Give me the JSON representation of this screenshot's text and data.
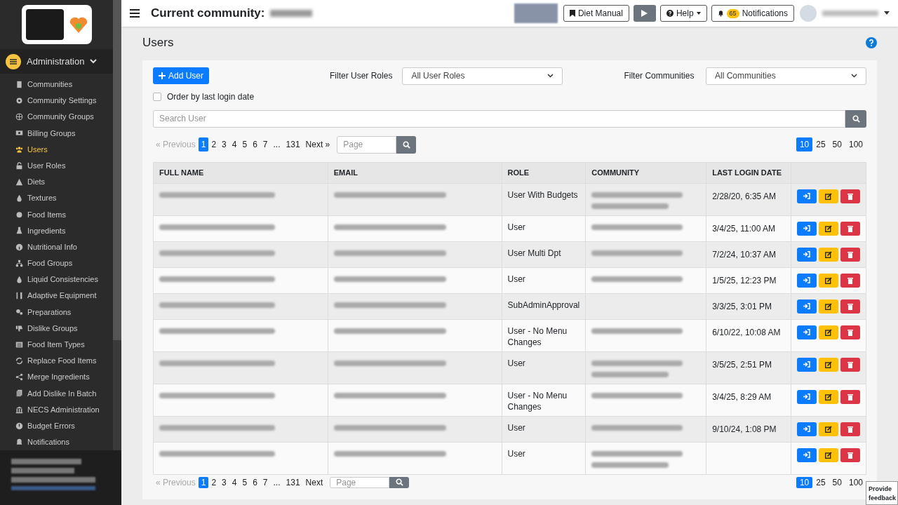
{
  "sidebar": {
    "section": {
      "label": "Administration",
      "expanded": true
    },
    "items": [
      {
        "label": "Communities",
        "selected": false
      },
      {
        "label": "Community Settings",
        "selected": false
      },
      {
        "label": "Community Groups",
        "selected": false
      },
      {
        "label": "Billing Groups",
        "selected": false
      },
      {
        "label": "Users",
        "selected": true
      },
      {
        "label": "User Roles",
        "selected": false
      },
      {
        "label": "Diets",
        "selected": false
      },
      {
        "label": "Textures",
        "selected": false
      },
      {
        "label": "Food Items",
        "selected": false
      },
      {
        "label": "Ingredients",
        "selected": false
      },
      {
        "label": "Nutritional Info",
        "selected": false
      },
      {
        "label": "Food Groups",
        "selected": false
      },
      {
        "label": "Liquid Consistencies",
        "selected": false
      },
      {
        "label": "Adaptive Equipment",
        "selected": false
      },
      {
        "label": "Preparations",
        "selected": false
      },
      {
        "label": "Dislike Groups",
        "selected": false
      },
      {
        "label": "Food Item Types",
        "selected": false
      },
      {
        "label": "Replace Food Items",
        "selected": false
      },
      {
        "label": "Merge Ingredients",
        "selected": false
      },
      {
        "label": "Add Dislike In Batch",
        "selected": false
      },
      {
        "label": "NECS Administration",
        "selected": false
      },
      {
        "label": "Budget Errors",
        "selected": false
      },
      {
        "label": "Notifications",
        "selected": false
      }
    ]
  },
  "header": {
    "title": "Current community:",
    "buttons": [
      "Diet Manual",
      "Help"
    ],
    "notifications": {
      "label": "Notifications",
      "count": "65"
    }
  },
  "page": {
    "title": "Users"
  },
  "toolbar": {
    "add_button": "Add User",
    "role_filter": {
      "label": "Filter User Roles",
      "value": "All User Roles"
    },
    "community_filter": {
      "label": "Filter Communities",
      "value": "All Communities"
    },
    "order_checkbox": {
      "label": "Order by last login date",
      "checked": false
    },
    "search": {
      "placeholder": "Search User"
    }
  },
  "pagination": {
    "pages": [
      {
        "label": "« Previous",
        "disabled": true,
        "selected": false
      },
      {
        "label": "1",
        "disabled": false,
        "selected": true
      },
      {
        "label": "2",
        "disabled": false,
        "selected": false
      },
      {
        "label": "3",
        "disabled": false,
        "selected": false
      },
      {
        "label": "4",
        "disabled": false,
        "selected": false
      },
      {
        "label": "5",
        "disabled": false,
        "selected": false
      },
      {
        "label": "6",
        "disabled": false,
        "selected": false
      },
      {
        "label": "7",
        "disabled": false,
        "selected": false
      },
      {
        "label": "...",
        "disabled": false,
        "selected": false
      },
      {
        "label": "131",
        "disabled": false,
        "selected": false
      },
      {
        "label": "Next »",
        "disabled": false,
        "selected": false
      }
    ],
    "page_placeholder": "Page",
    "page_sizes": [
      {
        "label": "10",
        "selected": true
      },
      {
        "label": "25",
        "selected": false
      },
      {
        "label": "50",
        "selected": false
      },
      {
        "label": "100",
        "selected": false
      }
    ]
  },
  "table": {
    "columns": [
      "FULL NAME",
      "EMAIL",
      "ROLE",
      "COMMUNITY",
      "LAST LOGIN DATE"
    ],
    "rows": [
      {
        "role": "User With Budgets",
        "community": true,
        "community_long": true,
        "last_login": "2/28/20, 6:35 AM"
      },
      {
        "role": "User",
        "community": true,
        "community_long": false,
        "last_login": "3/4/25, 11:00 AM"
      },
      {
        "role": "User Multi Dpt",
        "community": true,
        "community_long": false,
        "last_login": "7/2/24, 10:37 AM"
      },
      {
        "role": "User",
        "community": true,
        "community_long": false,
        "last_login": "1/5/25, 12:23 PM"
      },
      {
        "role": "SubAdminApproval",
        "community": false,
        "community_long": false,
        "last_login": "3/3/25, 3:01 PM"
      },
      {
        "role": "User - No Menu Changes",
        "community": true,
        "community_long": false,
        "last_login": "6/10/22, 10:08 AM"
      },
      {
        "role": "User",
        "community": true,
        "community_long": true,
        "last_login": "3/5/25, 2:51 PM"
      },
      {
        "role": "User - No Menu Changes",
        "community": true,
        "community_long": false,
        "last_login": "3/4/25, 8:29 AM"
      },
      {
        "role": "User",
        "community": true,
        "community_long": false,
        "last_login": "9/10/24, 1:08 PM"
      },
      {
        "role": "User",
        "community": true,
        "community_long": true
      }
    ]
  },
  "bottom_pagination": {
    "pages": [
      {
        "label": "« Previous",
        "disabled": true,
        "selected": false
      },
      {
        "label": "1",
        "disabled": false,
        "selected": true
      },
      {
        "label": "2",
        "disabled": false,
        "selected": false
      },
      {
        "label": "3",
        "disabled": false,
        "selected": false
      },
      {
        "label": "4",
        "disabled": false,
        "selected": false
      },
      {
        "label": "5",
        "disabled": false,
        "selected": false
      },
      {
        "label": "6",
        "disabled": false,
        "selected": false
      },
      {
        "label": "7",
        "disabled": false,
        "selected": false
      },
      {
        "label": "...",
        "disabled": false,
        "selected": false
      },
      {
        "label": "131",
        "disabled": false,
        "selected": false
      },
      {
        "label": "Next",
        "disabled": false,
        "selected": false
      }
    ],
    "page_placeholder": "Page",
    "page_sizes": [
      {
        "label": "10",
        "selected": true
      },
      {
        "label": "25",
        "selected": false
      },
      {
        "label": "50",
        "selected": false
      },
      {
        "label": "100",
        "selected": false
      }
    ]
  },
  "feedback": "Provide feedback"
}
